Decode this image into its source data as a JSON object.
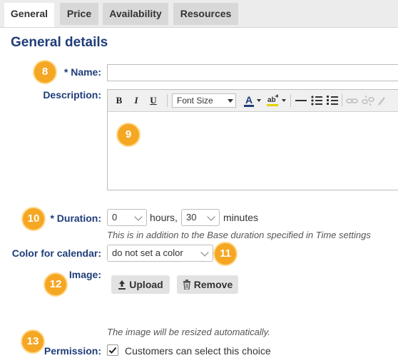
{
  "tabs": [
    {
      "label": "General",
      "active": true
    },
    {
      "label": "Price"
    },
    {
      "label": "Availability"
    },
    {
      "label": "Resources"
    }
  ],
  "section": {
    "title": "General details"
  },
  "fields": {
    "name": {
      "required_mark": "*",
      "label": "Name:",
      "value": ""
    },
    "description": {
      "label": "Description:",
      "font_size_label": "Font Size"
    },
    "duration": {
      "required_mark": "*",
      "label": "Duration:",
      "hours_value": "0",
      "hours_unit": "hours,",
      "minutes_value": "30",
      "minutes_unit": "minutes",
      "hint": "This is in addition to the Base duration specified in Time settings"
    },
    "color": {
      "label": "Color for calendar:",
      "value": "do not set a color"
    },
    "image": {
      "label": "Image:",
      "upload_label": "Upload",
      "remove_label": "Remove",
      "hint": "The image will be resized automatically."
    },
    "permission": {
      "label": "Permission:",
      "checkbox_label": "Customers can select this choice",
      "checked": true
    }
  },
  "editor_toolbar": {
    "bold": "B",
    "italic": "I",
    "underline": "U"
  },
  "badges": [
    "8",
    "9",
    "10",
    "11",
    "12",
    "13"
  ],
  "colors": {
    "heading": "#1f3d7a",
    "badge": "#f5a623",
    "tab_bg": "#d8d8d8"
  }
}
